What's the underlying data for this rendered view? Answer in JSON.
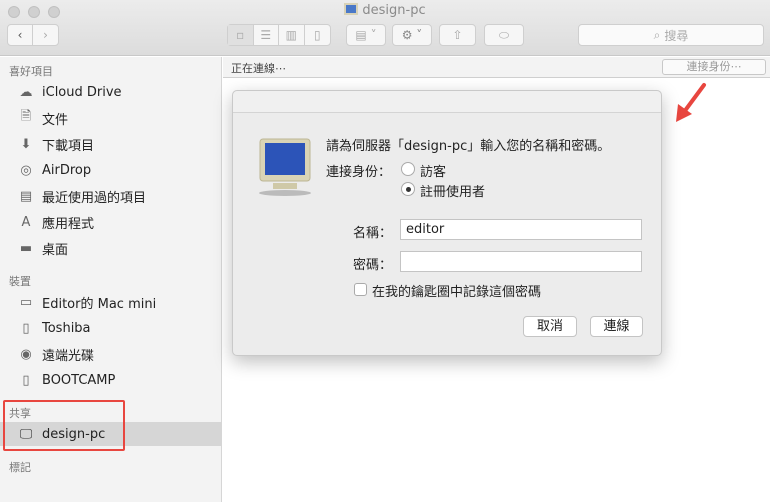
{
  "window": {
    "title": "design-pc"
  },
  "toolbar": {
    "search_placeholder": "搜尋"
  },
  "sidebar": {
    "favorites_header": "喜好項目",
    "favorites": [
      {
        "label": "iCloud Drive",
        "icon": "cloud-icon"
      },
      {
        "label": "文件",
        "icon": "document-icon"
      },
      {
        "label": "下載項目",
        "icon": "download-icon"
      },
      {
        "label": "AirDrop",
        "icon": "airdrop-icon"
      },
      {
        "label": "最近使用過的項目",
        "icon": "recents-icon"
      },
      {
        "label": "應用程式",
        "icon": "applications-icon"
      },
      {
        "label": "桌面",
        "icon": "desktop-icon"
      }
    ],
    "devices_header": "裝置",
    "devices": [
      {
        "label": "Editor的 Mac mini",
        "icon": "computer-icon"
      },
      {
        "label": "Toshiba",
        "icon": "drive-icon"
      },
      {
        "label": "遠端光碟",
        "icon": "disc-icon"
      },
      {
        "label": "BOOTCAMP",
        "icon": "drive-icon"
      }
    ],
    "shared_header": "共享",
    "shared": [
      {
        "label": "design-pc",
        "icon": "pc-monitor-icon",
        "selected": true
      }
    ],
    "tags_header": "標記"
  },
  "pathbar": {
    "status": "正在連線⋯",
    "connect_as": "連接身份⋯"
  },
  "dialog": {
    "message": "請為伺服器「design-pc」輸入您的名稱和密碼。",
    "connect_as_label": "連接身份：",
    "options": [
      {
        "label": "訪客",
        "selected": false
      },
      {
        "label": "註冊使用者",
        "selected": true
      }
    ],
    "name_label": "名稱：",
    "name_value": "editor",
    "password_label": "密碼：",
    "password_value": "",
    "remember_label": "在我的鑰匙圈中記錄這個密碼",
    "remember_checked": false,
    "cancel": "取消",
    "connect": "連線"
  },
  "colors": {
    "annotation": "#e8463f",
    "selection": "#d6d6d6"
  }
}
